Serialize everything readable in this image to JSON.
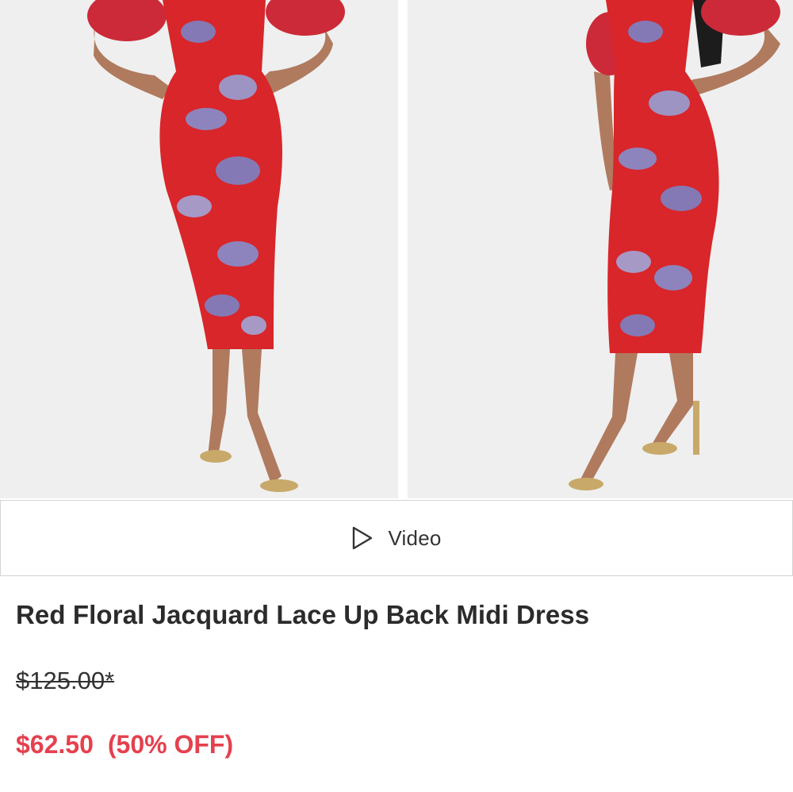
{
  "gallery": {
    "images": [
      {
        "alt": "Model front view in red floral jacquard midi dress"
      },
      {
        "alt": "Model side view in red floral jacquard midi dress"
      }
    ]
  },
  "video": {
    "label": "Video",
    "icon": "play-icon"
  },
  "product": {
    "title": "Red Floral Jacquard Lace Up Back Midi Dress",
    "original_price": "$125.00*",
    "sale_price": "$62.50",
    "discount": "(50% OFF)"
  },
  "colors": {
    "sale": "#e5404e",
    "dress_red": "#d8262a",
    "pattern_blue": "#7f9fe0"
  }
}
